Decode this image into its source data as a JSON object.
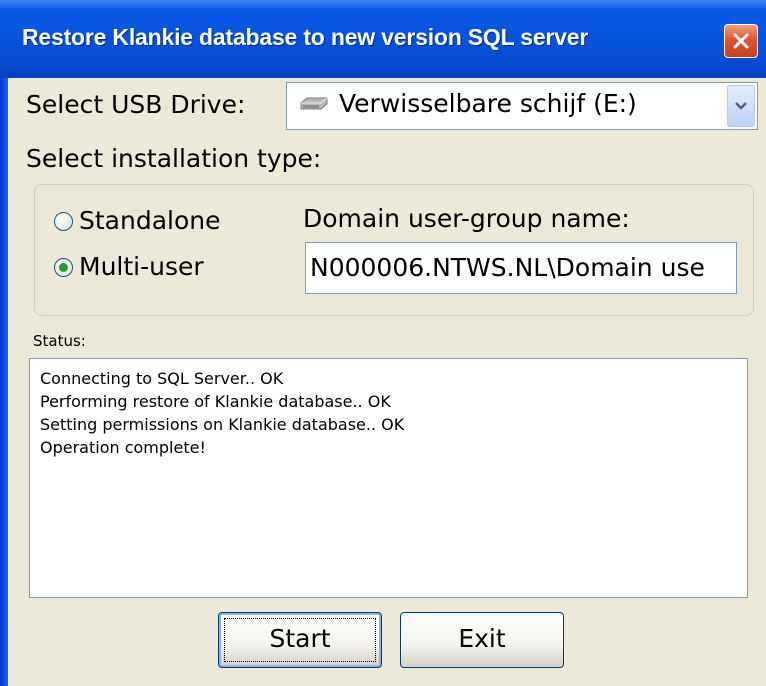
{
  "window": {
    "title": "Restore Klankie database to new version SQL server"
  },
  "usb": {
    "label": "Select USB Drive:",
    "selected": "Verwisselbare schijf (E:)"
  },
  "install": {
    "label": "Select installation type:",
    "options": [
      {
        "label": "Standalone",
        "selected": false
      },
      {
        "label": "Multi-user",
        "selected": true
      }
    ],
    "domain_label": "Domain user-group name:",
    "domain_value": "N000006.NTWS.NL\\Domain use"
  },
  "status": {
    "label": "Status:",
    "lines": [
      "Connecting to SQL Server.. OK",
      "Performing restore of Klankie database.. OK",
      "Setting permissions on Klankie database.. OK",
      "Operation complete!"
    ]
  },
  "buttons": {
    "start": "Start",
    "exit": "Exit"
  },
  "icons": {
    "close": "close-icon",
    "drive": "usb-drive-icon",
    "dropdown": "chevron-down-icon"
  },
  "colors": {
    "titlebar": "#0753dd",
    "close": "#e2542e",
    "radio_selected": "#21a121",
    "face": "#ece9d8"
  }
}
